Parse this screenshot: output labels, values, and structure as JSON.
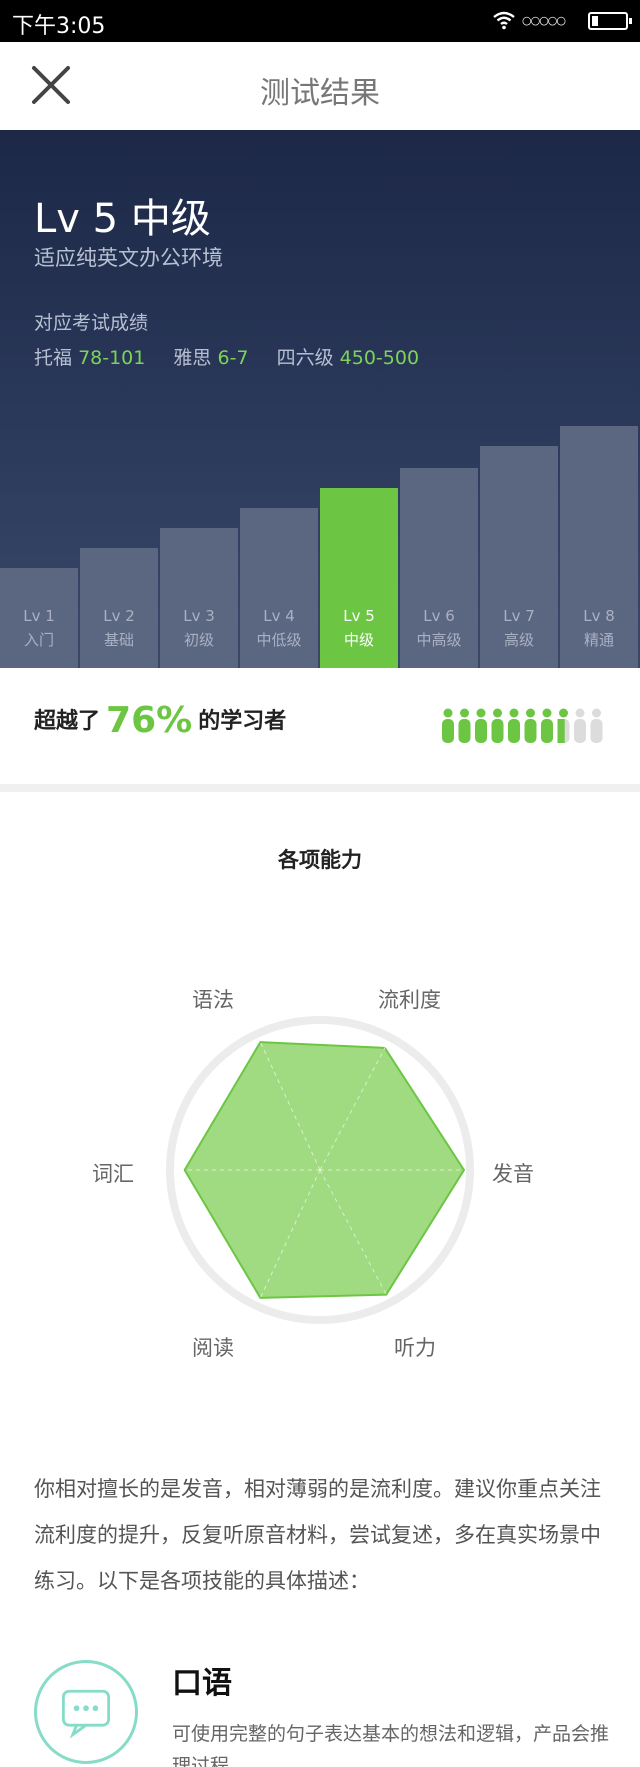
{
  "status_bar": {
    "time": "下午3:05"
  },
  "header": {
    "title": "测试结果"
  },
  "hero": {
    "level_title": "Lv 5 中级",
    "level_desc": "适应纯英文办公环境",
    "exam_label": "对应考试成绩",
    "exams": [
      {
        "name": "托福",
        "value": "78-101"
      },
      {
        "name": "雅思",
        "value": "6-7"
      },
      {
        "name": "四六级",
        "value": "450-500"
      }
    ]
  },
  "levels": [
    {
      "lv": "Lv 1",
      "name": "入门"
    },
    {
      "lv": "Lv 2",
      "name": "基础"
    },
    {
      "lv": "Lv 3",
      "name": "初级"
    },
    {
      "lv": "Lv 4",
      "name": "中低级"
    },
    {
      "lv": "Lv 5",
      "name": "中级"
    },
    {
      "lv": "Lv 6",
      "name": "中高级"
    },
    {
      "lv": "Lv 7",
      "name": "高级"
    },
    {
      "lv": "Lv 8",
      "name": "精通"
    }
  ],
  "active_level_index": 4,
  "percentile": {
    "prefix": "超越了",
    "value": "76%",
    "suffix": "的学习者",
    "filled_people": 7.6,
    "total_people": 10
  },
  "abilities": {
    "title": "各项能力",
    "labels": [
      "语法",
      "流利度",
      "发音",
      "听力",
      "阅读",
      "词汇"
    ]
  },
  "summary": "你相对擅长的是发音，相对薄弱的是流利度。建议你重点关注流利度的提升，反复听原音材料，尝试复述，多在真实场景中练习。以下是各项技能的具体描述：",
  "skill": {
    "title": "口语",
    "desc": "可使用完整的句子表达基本的想法和逻辑，产品会推理过程。"
  },
  "colors": {
    "accent": "#6cc644",
    "hero_bg": "#1d2847",
    "bar": "#5b6680"
  }
}
